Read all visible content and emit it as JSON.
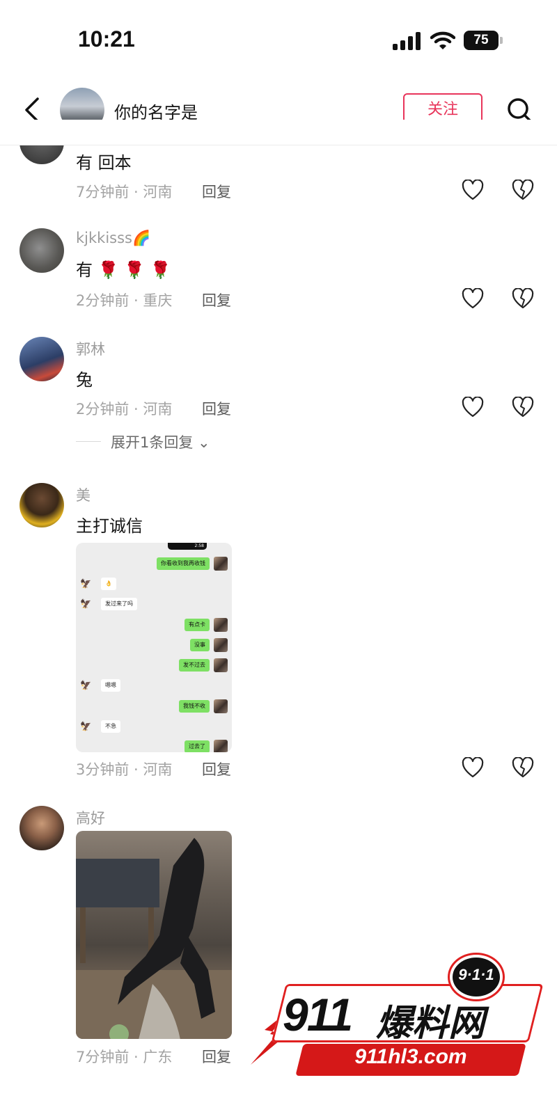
{
  "status_bar": {
    "time": "10:21",
    "battery": "75"
  },
  "header": {
    "title": "你的名字是",
    "follow_label": "关注"
  },
  "comments": [
    {
      "username": "",
      "text": "有 回本",
      "meta": "7分钟前 · 河南",
      "reply_label": "回复"
    },
    {
      "username": "kjkkisss🌈",
      "text": "有 🌹 🌹 🌹",
      "meta": "2分钟前 · 重庆",
      "reply_label": "回复"
    },
    {
      "username": "郭林",
      "text": "兔",
      "meta": "2分钟前 · 河南",
      "reply_label": "回复",
      "expand_label": "展开1条回复 ⌄"
    },
    {
      "username": "美",
      "text": "主打诚信",
      "meta": "3分钟前 · 河南",
      "reply_label": "回复",
      "image_chat": {
        "time": "2:58",
        "messages": [
          {
            "side": "right",
            "text": "你看收到我再收钱"
          },
          {
            "side": "left",
            "text": "👌"
          },
          {
            "side": "left",
            "text": "发过来了吗"
          },
          {
            "side": "right",
            "text": "有点卡"
          },
          {
            "side": "right",
            "text": "没事"
          },
          {
            "side": "right",
            "text": "发不过去"
          },
          {
            "side": "left",
            "text": "嗯嗯"
          },
          {
            "side": "right",
            "text": "我钱不收"
          },
          {
            "side": "left",
            "text": "不急"
          },
          {
            "side": "right",
            "text": "过去了"
          }
        ]
      }
    },
    {
      "username": "高好",
      "text": "",
      "meta": "7分钟前 · 广东",
      "reply_label": "回复"
    }
  ],
  "watermark": {
    "badge": "9·1·1",
    "brand_num": "911",
    "brand_cn": "爆料网",
    "url": "911hl3.com"
  },
  "colors": {
    "accent": "#e8345a",
    "chat_green": "#7ee064",
    "watermark_red": "#d51818"
  },
  "icons": [
    "back-icon",
    "search-icon",
    "heart-icon",
    "broken-heart-icon",
    "signal-icon",
    "wifi-icon",
    "battery-icon"
  ]
}
